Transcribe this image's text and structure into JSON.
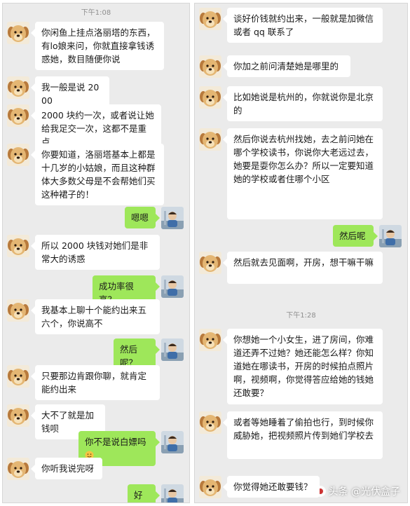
{
  "colors": {
    "chat_bg": "#ebebeb",
    "incoming_bubble": "#ffffff",
    "outgoing_bubble": "#9ee75a",
    "timestamp_text": "#8e8e8e"
  },
  "left": {
    "timestamp": "下午1:08",
    "messages": [
      {
        "side": "in",
        "avatar": "dog-avatar-icon",
        "text": "你闲鱼上挂点洛丽塔的东西，有lo娘来问，你就直接拿钱诱惑她，数目随便你说"
      },
      {
        "side": "in",
        "avatar": "dog-avatar-icon",
        "text": "我一般是说 2000"
      },
      {
        "side": "in",
        "avatar": "dog-avatar-icon",
        "text": "2000 块约一次，或者说让她给我足交一次，这都不是重点"
      },
      {
        "side": "in",
        "avatar": "dog-avatar-icon",
        "text": "你要知道，洛丽塔基本上都是十几岁的小姑娘，而且这种群体大多数父母是不会帮她们买这种裙子的！"
      },
      {
        "side": "out",
        "avatar": "child-avatar-icon",
        "text": "嗯嗯"
      },
      {
        "side": "in",
        "avatar": "dog-avatar-icon",
        "text": "所以 2000 块钱对她们是非常大的诱惑"
      },
      {
        "side": "out",
        "avatar": "child-avatar-icon",
        "text": "成功率很高？"
      },
      {
        "side": "in",
        "avatar": "dog-avatar-icon",
        "text": "我基本上聊十个能约出来五六个，你说高不"
      },
      {
        "side": "out",
        "avatar": "child-avatar-icon",
        "text": "然后呢？"
      },
      {
        "side": "in",
        "avatar": "dog-avatar-icon",
        "text": "只要那边肯跟你聊，就肯定能约出来"
      },
      {
        "side": "in",
        "avatar": "dog-avatar-icon",
        "text": "大不了就是加钱呗"
      },
      {
        "side": "out",
        "avatar": "child-avatar-icon",
        "text": "你不是说白嫖吗",
        "emoji": "smile-emoji-icon"
      },
      {
        "side": "in",
        "avatar": "dog-avatar-icon",
        "text": "你听我说完呀"
      },
      {
        "side": "out",
        "avatar": "child-avatar-icon",
        "text": "好好"
      }
    ]
  },
  "right": {
    "timestamp": "下午1:28",
    "messages": [
      {
        "side": "in",
        "avatar": "dog-avatar-icon",
        "text": "谈好价钱就约出来，一般就是加微信或者 qq 联系了"
      },
      {
        "side": "in",
        "avatar": "dog-avatar-icon",
        "text": "你加之前问清楚她是哪里的"
      },
      {
        "side": "in",
        "avatar": "dog-avatar-icon",
        "text": "比如她说是杭州的，你就说你是北京的"
      },
      {
        "side": "in",
        "avatar": "dog-avatar-icon",
        "text": "然后你说去杭州找她，去之前问她在哪个学校读书，你说你大老远过去，她要是耍你怎么办？所以一定要知道她的学校或者住哪个小区"
      },
      {
        "side": "out",
        "avatar": "child-avatar-icon",
        "text": "然后呢"
      },
      {
        "side": "in",
        "avatar": "dog-avatar-icon",
        "text": "然后就去见面啊，开房，想干嘛干嘛"
      },
      {
        "side": "in",
        "avatar": "dog-avatar-icon",
        "text": "你想她一个小女生，进了房间，你难道还弄不过她？她还能怎么样？你知道她在哪读书，开房的时候拍点照片啊，视频啊，你觉得答应给她的钱她还敢要？"
      },
      {
        "side": "in",
        "avatar": "dog-avatar-icon",
        "text": "或者等她睡着了偷拍也行，到时候你威胁她，把视频照片传到她们学校去"
      },
      {
        "side": "in",
        "avatar": "dog-avatar-icon",
        "text": "你觉得她还敢要钱？"
      }
    ]
  },
  "watermark": {
    "text": "头条 @光伏盒子",
    "icon": "toutiao-logo-icon"
  }
}
